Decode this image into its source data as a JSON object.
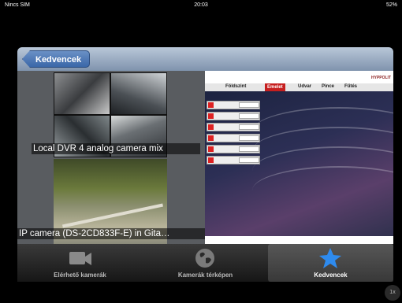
{
  "statusbar": {
    "carrier": "Nincs SIM",
    "time": "20:03",
    "battery": "52%"
  },
  "navbar": {
    "back_label": "Kedvencek"
  },
  "cameras": [
    {
      "caption": "Local DVR 4 analog camera mix"
    },
    {
      "caption": "IP camera (DS-2CD833F-E) in Gita…"
    }
  ],
  "dvr": {
    "tabs": [
      "Földszint",
      "Emelet",
      "Udvar",
      "Pince",
      "Fűtés"
    ],
    "active_tab": "Emelet",
    "logo": "HYPPOLIT"
  },
  "tabbar": {
    "items": [
      {
        "label": "Elérhető kamerák",
        "icon": "video-camera-icon"
      },
      {
        "label": "Kamerák térképen",
        "icon": "globe-icon"
      },
      {
        "label": "Kedvencek",
        "icon": "star-icon"
      }
    ],
    "active": "Kedvencek"
  },
  "zoom": {
    "label": "1x"
  },
  "colors": {
    "accent": "#3a67a8",
    "star": "#2e8bef",
    "dvr_active": "#c61f1f"
  }
}
